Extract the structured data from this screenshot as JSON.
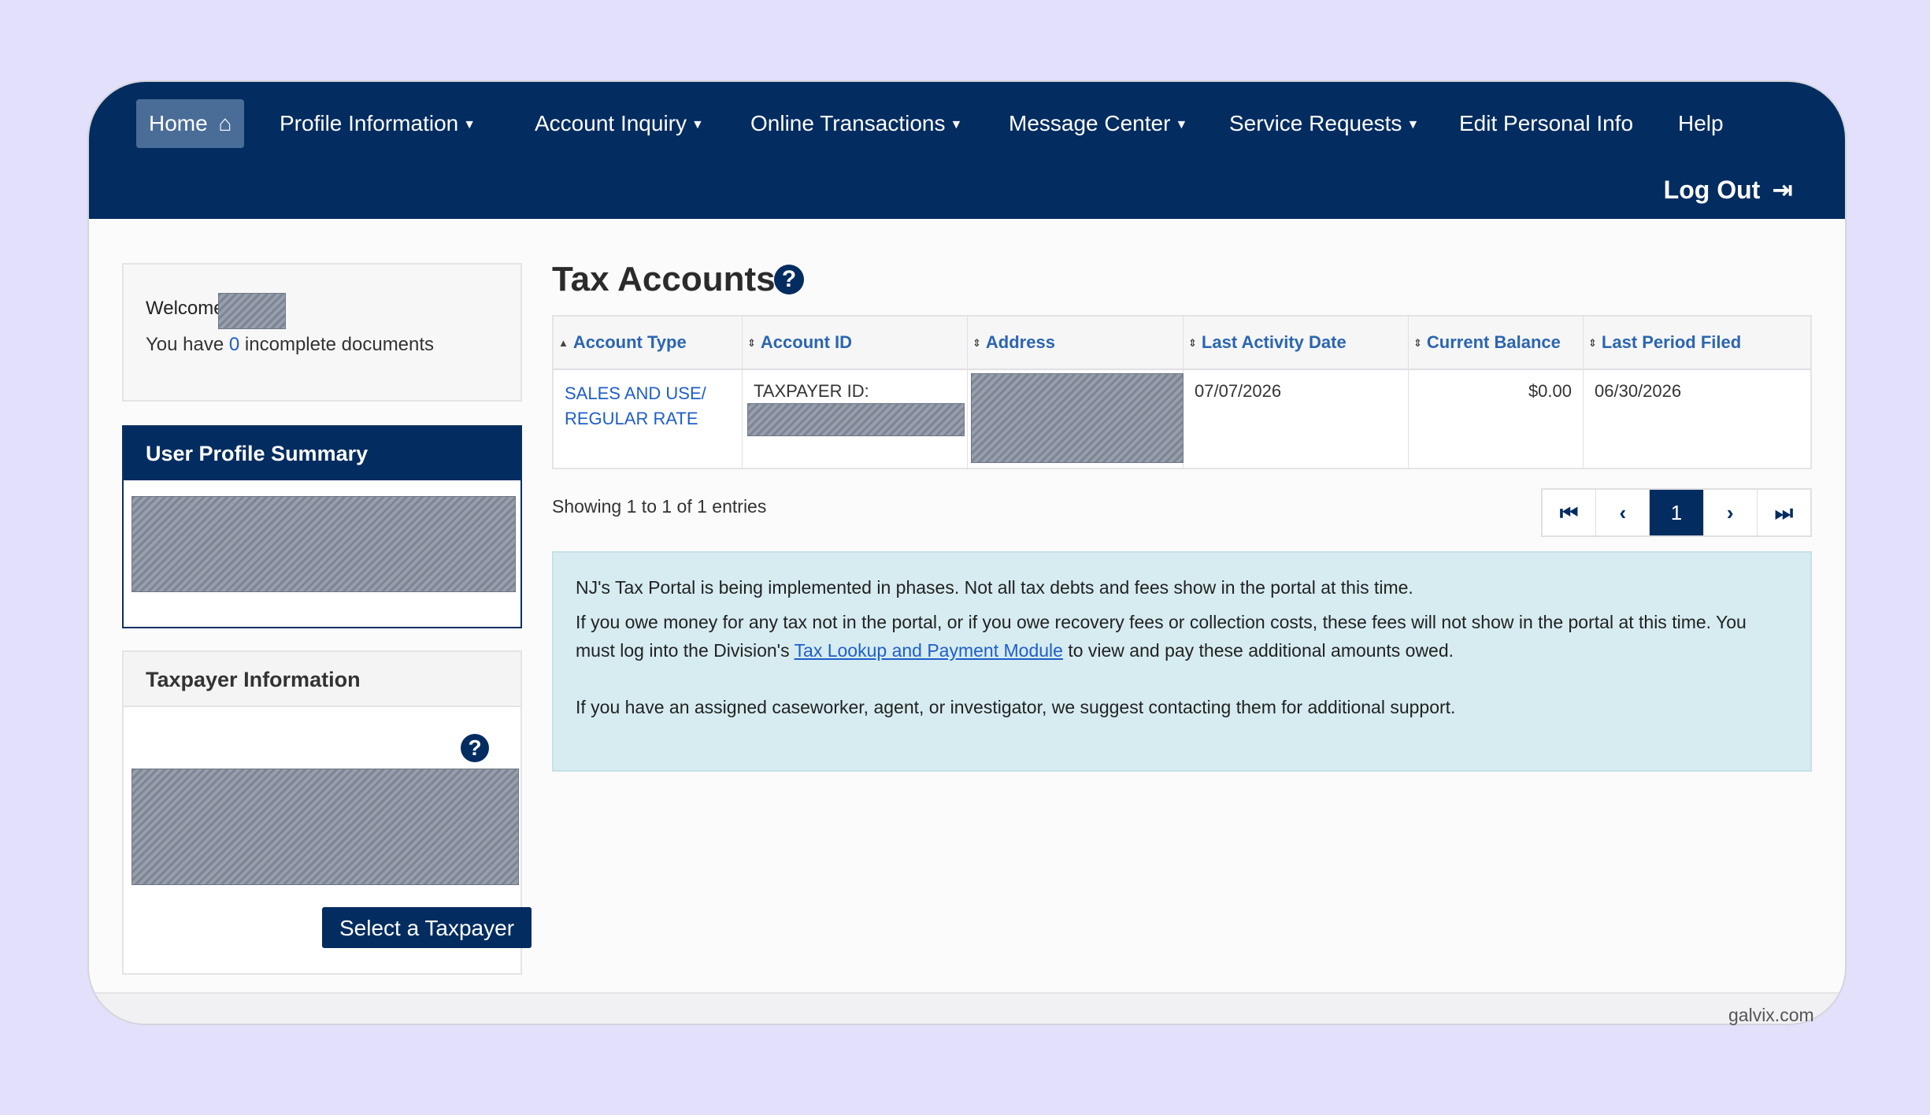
{
  "nav": {
    "home": "Home",
    "profile_information": "Profile Information",
    "account_inquiry": "Account Inquiry",
    "online_transactions": "Online Transactions",
    "message_center": "Message Center",
    "service_requests": "Service Requests",
    "edit_personal_info": "Edit Personal Info",
    "help": "Help",
    "logout": "Log Out"
  },
  "welcome": {
    "greeting": "Welcome",
    "incomplete_prefix": "You have ",
    "incomplete_count": "0",
    "incomplete_suffix": " incomplete documents"
  },
  "user_profile_summary": {
    "title": "User Profile Summary"
  },
  "taxpayer_information": {
    "title": "Taxpayer Information",
    "select_button": "Select a Taxpayer"
  },
  "tax_accounts": {
    "title": "Tax Accounts",
    "columns": [
      "Account Type",
      "Account ID",
      "Address",
      "Last Activity Date",
      "Current Balance",
      "Last Period Filed"
    ],
    "rows": [
      {
        "account_type_line1": "SALES AND USE/",
        "account_type_line2": "REGULAR RATE",
        "account_id_label": "TAXPAYER ID:",
        "last_activity_date": "07/07/2026",
        "current_balance": "$0.00",
        "last_period_filed": "06/30/2026"
      }
    ],
    "showing": "Showing 1 to 1 of 1 entries",
    "pagination": {
      "current_page": "1"
    }
  },
  "notice": {
    "line1": "NJ's Tax Portal is being implemented in phases. Not all tax debts and fees show in the portal at this time.",
    "line2a": "If you owe money for any tax not in the portal, or if you owe recovery fees or collection costs, these fees will not show in the portal at this time. You must log into the Division's ",
    "link": "Tax Lookup and Payment Module",
    "line2b": " to view and pay these additional amounts owed.",
    "line3": "If you have an assigned caseworker, agent, or investigator, we suggest contacting them for additional support."
  },
  "watermark": "galvix.com",
  "colors": {
    "navy": "#032c60",
    "link": "#1f5ec9",
    "notice_bg": "#d6ecf1",
    "page_bg": "#e2e0fa"
  }
}
